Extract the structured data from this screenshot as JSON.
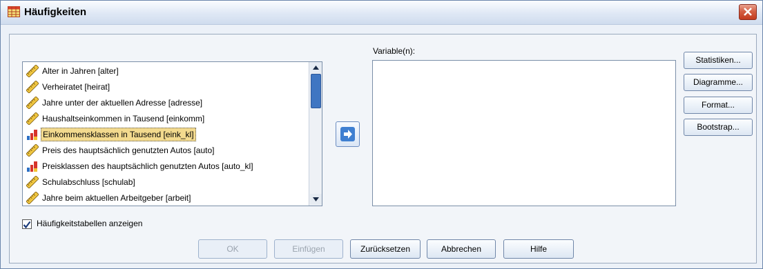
{
  "window": {
    "title": "Häufigkeiten",
    "colors": {
      "titlebar": "#dfe8f5",
      "selection": "#f3da8e",
      "close": "#c33b1e"
    }
  },
  "source_list": {
    "items": [
      {
        "label": "Alter in Jahren [alter]",
        "icon": "ruler-icon",
        "selected": false
      },
      {
        "label": "Verheiratet [heirat]",
        "icon": "ruler-icon",
        "selected": false
      },
      {
        "label": "Jahre unter der aktuellen Adresse [adresse]",
        "icon": "ruler-icon",
        "selected": false
      },
      {
        "label": "Haushaltseinkommen in Tausend [einkomm]",
        "icon": "ruler-icon",
        "selected": false
      },
      {
        "label": "Einkommensklassen in Tausend [eink_kl]",
        "icon": "ordinal-bars-icon",
        "selected": true
      },
      {
        "label": "Preis des hauptsächlich genutzten Autos [auto]",
        "icon": "ruler-icon",
        "selected": false
      },
      {
        "label": "Preisklassen des hauptsächlich genutzten Autos [auto_kl]",
        "icon": "ordinal-bars-icon",
        "selected": false
      },
      {
        "label": "Schulabschluss [schulab]",
        "icon": "ruler-icon",
        "selected": false
      },
      {
        "label": "Jahre beim aktuellen Arbeitgeber [arbeit]",
        "icon": "ruler-icon",
        "selected": false
      }
    ]
  },
  "target": {
    "label": "Variable(n):"
  },
  "side_buttons": {
    "statistiken": "Statistiken...",
    "diagramme": "Diagramme...",
    "format": "Format...",
    "bootstrap": "Bootstrap..."
  },
  "checkbox": {
    "label": "Häufigkeitstabellen anzeigen",
    "checked": true
  },
  "bottom_buttons": {
    "ok": "OK",
    "einfuegen": "Einfügen",
    "zuruecksetzen": "Zurücksetzen",
    "abbrechen": "Abbrechen",
    "hilfe": "Hilfe"
  }
}
